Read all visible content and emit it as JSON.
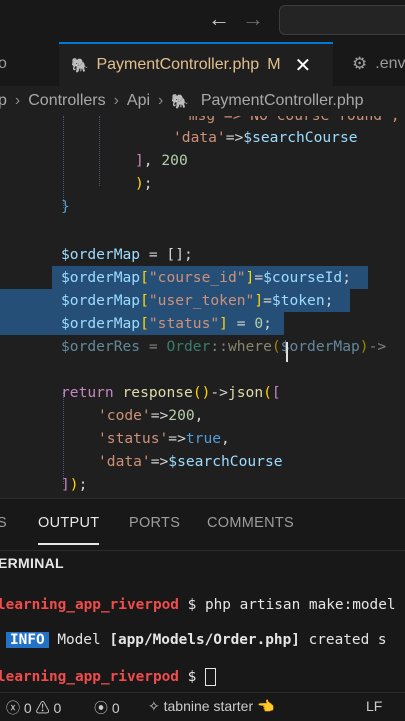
{
  "titlebar": {
    "back_icon": "arrow-left-icon",
    "forward_icon": "arrow-right-icon"
  },
  "tabs": {
    "left_partial": "o",
    "active": {
      "name": "PaymentController.php",
      "badge": "M"
    },
    "env": ".env"
  },
  "breadcrumb": [
    "p",
    "Controllers",
    "Api",
    "PaymentController.php"
  ],
  "code": {
    "l1": "'msg'=>'No course found',",
    "l2_key": "'data'",
    "l2_val": "$searchCourse",
    "l3_num": "200",
    "l5": "}",
    "l7_var": "$orderMap",
    "l7_rest": " = [];",
    "l8_key": "\"course_id\"",
    "l8_val": "$courseId",
    "l9_key": "\"user_token\"",
    "l9_val": "$token",
    "l10_key": "\"status\"",
    "l10_num": "0",
    "l11_var": "$orderRes",
    "l11_cls": "Order",
    "l11_fn": "where",
    "l11_arg": "$orderMap",
    "l13_kw": "return",
    "l13_fn": "response",
    "l13_fn2": "json",
    "l14_key": "'code'",
    "l14_num": "200",
    "l15_key": "'status'",
    "l15_val": "true",
    "l16_key": "'data'",
    "l16_val": "$searchCourse"
  },
  "panel": {
    "tabs": [
      "S",
      "OUTPUT",
      "PORTS",
      "COMMENTS"
    ],
    "active": "OUTPUT"
  },
  "terminal": {
    "header": "ERMINAL",
    "line1_prompt": "learning_app_riverpod",
    "line1_cmd": " $ php artisan make:model",
    "line2_badge": "INFO",
    "line2_a": " Model ",
    "line2_b": "[app/Models/Order.php]",
    "line2_c": " created s",
    "line3_prompt": "learning_app_riverpod",
    "line3_cmd": " $ "
  },
  "statusbar": {
    "errors": "0",
    "warnings": "0",
    "ports": "0",
    "tabnine": "tabnine starter",
    "eol": "LF"
  }
}
